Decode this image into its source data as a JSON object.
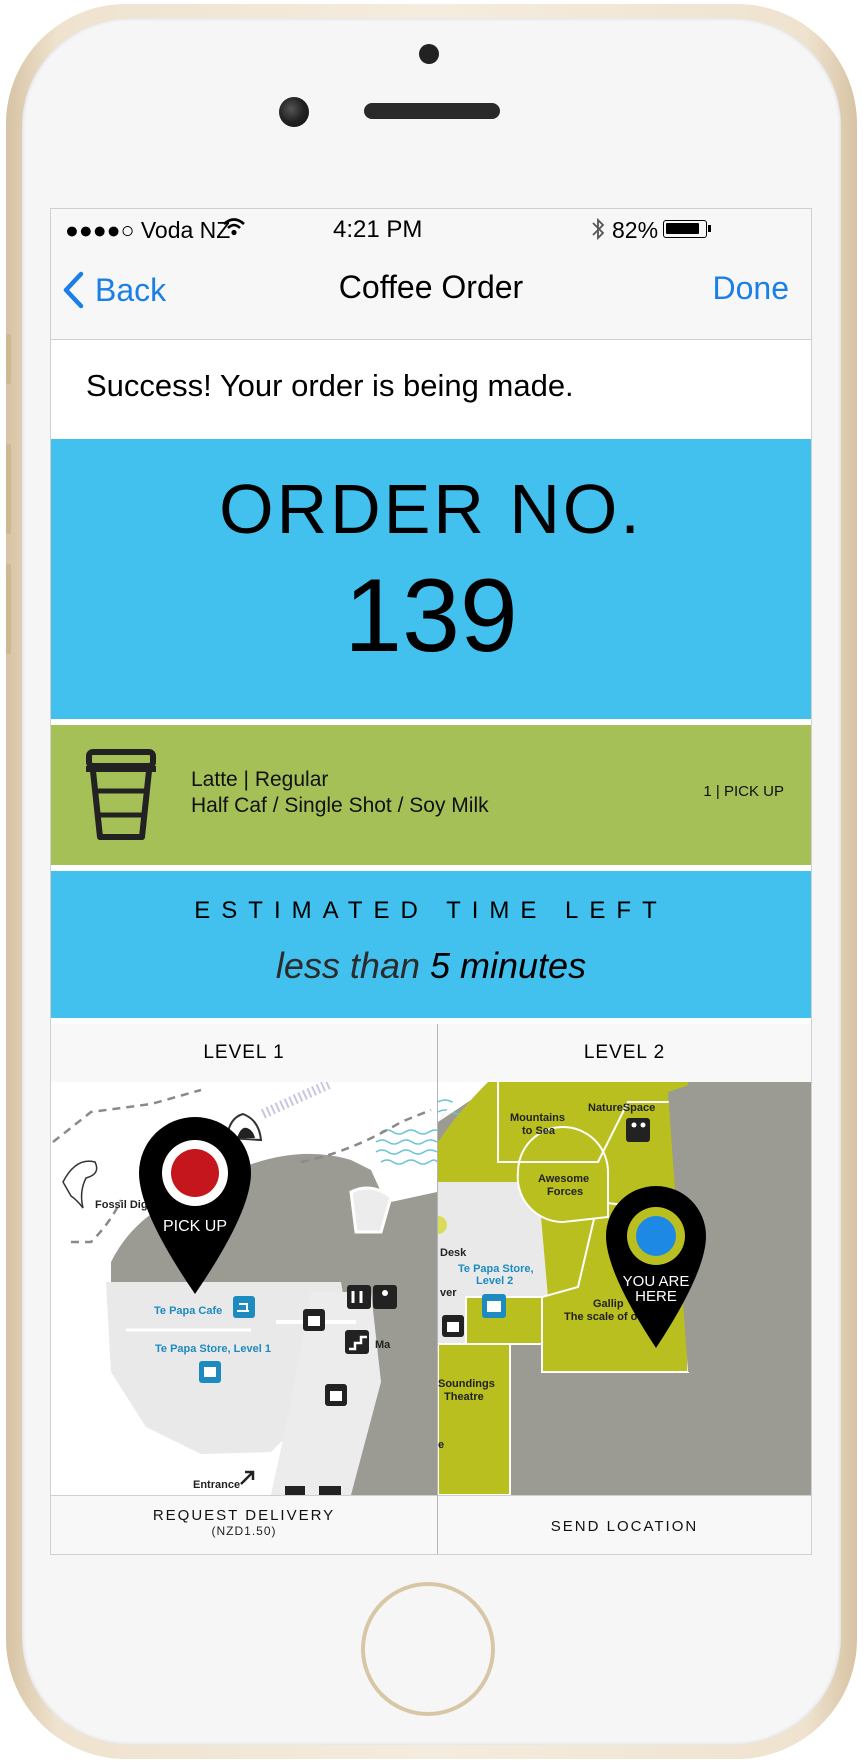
{
  "status_bar": {
    "carrier": "●●●●○ Voda NZ",
    "time": "4:21 PM",
    "battery": "82%",
    "icons": [
      "wifi-icon",
      "bluetooth-icon",
      "battery-icon"
    ]
  },
  "nav": {
    "back_label": "Back",
    "title": "Coffee Order",
    "done_label": "Done"
  },
  "success_message": "Success! Your order is being made.",
  "order": {
    "label": "ORDER NO.",
    "number": "139"
  },
  "item": {
    "icon": "coffee-cup-icon",
    "name": "Latte | Regular",
    "options": "Half Caf / Single Shot / Soy Milk",
    "meta": "1 | PICK UP"
  },
  "eta": {
    "label": "ESTIMATED TIME LEFT",
    "prefix": "less than ",
    "value": "5 minutes"
  },
  "levels": {
    "left": "LEVEL 1",
    "right": "LEVEL 2"
  },
  "map": {
    "level1": {
      "pin_label": "PICK UP",
      "labels": {
        "fossil": "Fossil Dig",
        "cafe_partial": "Ca",
        "cafe": "Te Papa Cafe",
        "store": "Te Papa Store, Level 1",
        "entrance": "Entrance",
        "ma_partial": "Ma"
      }
    },
    "level2": {
      "pin_label_line1": "YOU ARE",
      "pin_label_line2": "HERE",
      "labels": {
        "mountains": "Mountains",
        "to_sea": "to Sea",
        "naturespace": "NatureSpace",
        "awesome": "Awesome",
        "forces": "Forces",
        "desk": "Desk",
        "store_line1": "Te Papa Store,",
        "store_line2": "Level 2",
        "gallipoli": "Gallip",
        "scale": "The scale of o",
        "soundings": "Soundings",
        "theatre": "Theatre",
        "ver": "ver",
        "e": "e"
      }
    },
    "colors": {
      "grey": "#9b9b93",
      "green": "#b9bf1f",
      "pin": "#000000",
      "pickup_dot": "#c4161c",
      "you_dot": "#1e88e5",
      "label_blue": "#1d8ac0"
    }
  },
  "actions": {
    "delivery_label": "REQUEST DELIVERY",
    "delivery_price": "(NZD1.50)",
    "send_label": "SEND LOCATION"
  },
  "colors": {
    "order_bg": "#42c1ef",
    "item_bg": "#a6c058",
    "accent": "#1a7fe6"
  }
}
